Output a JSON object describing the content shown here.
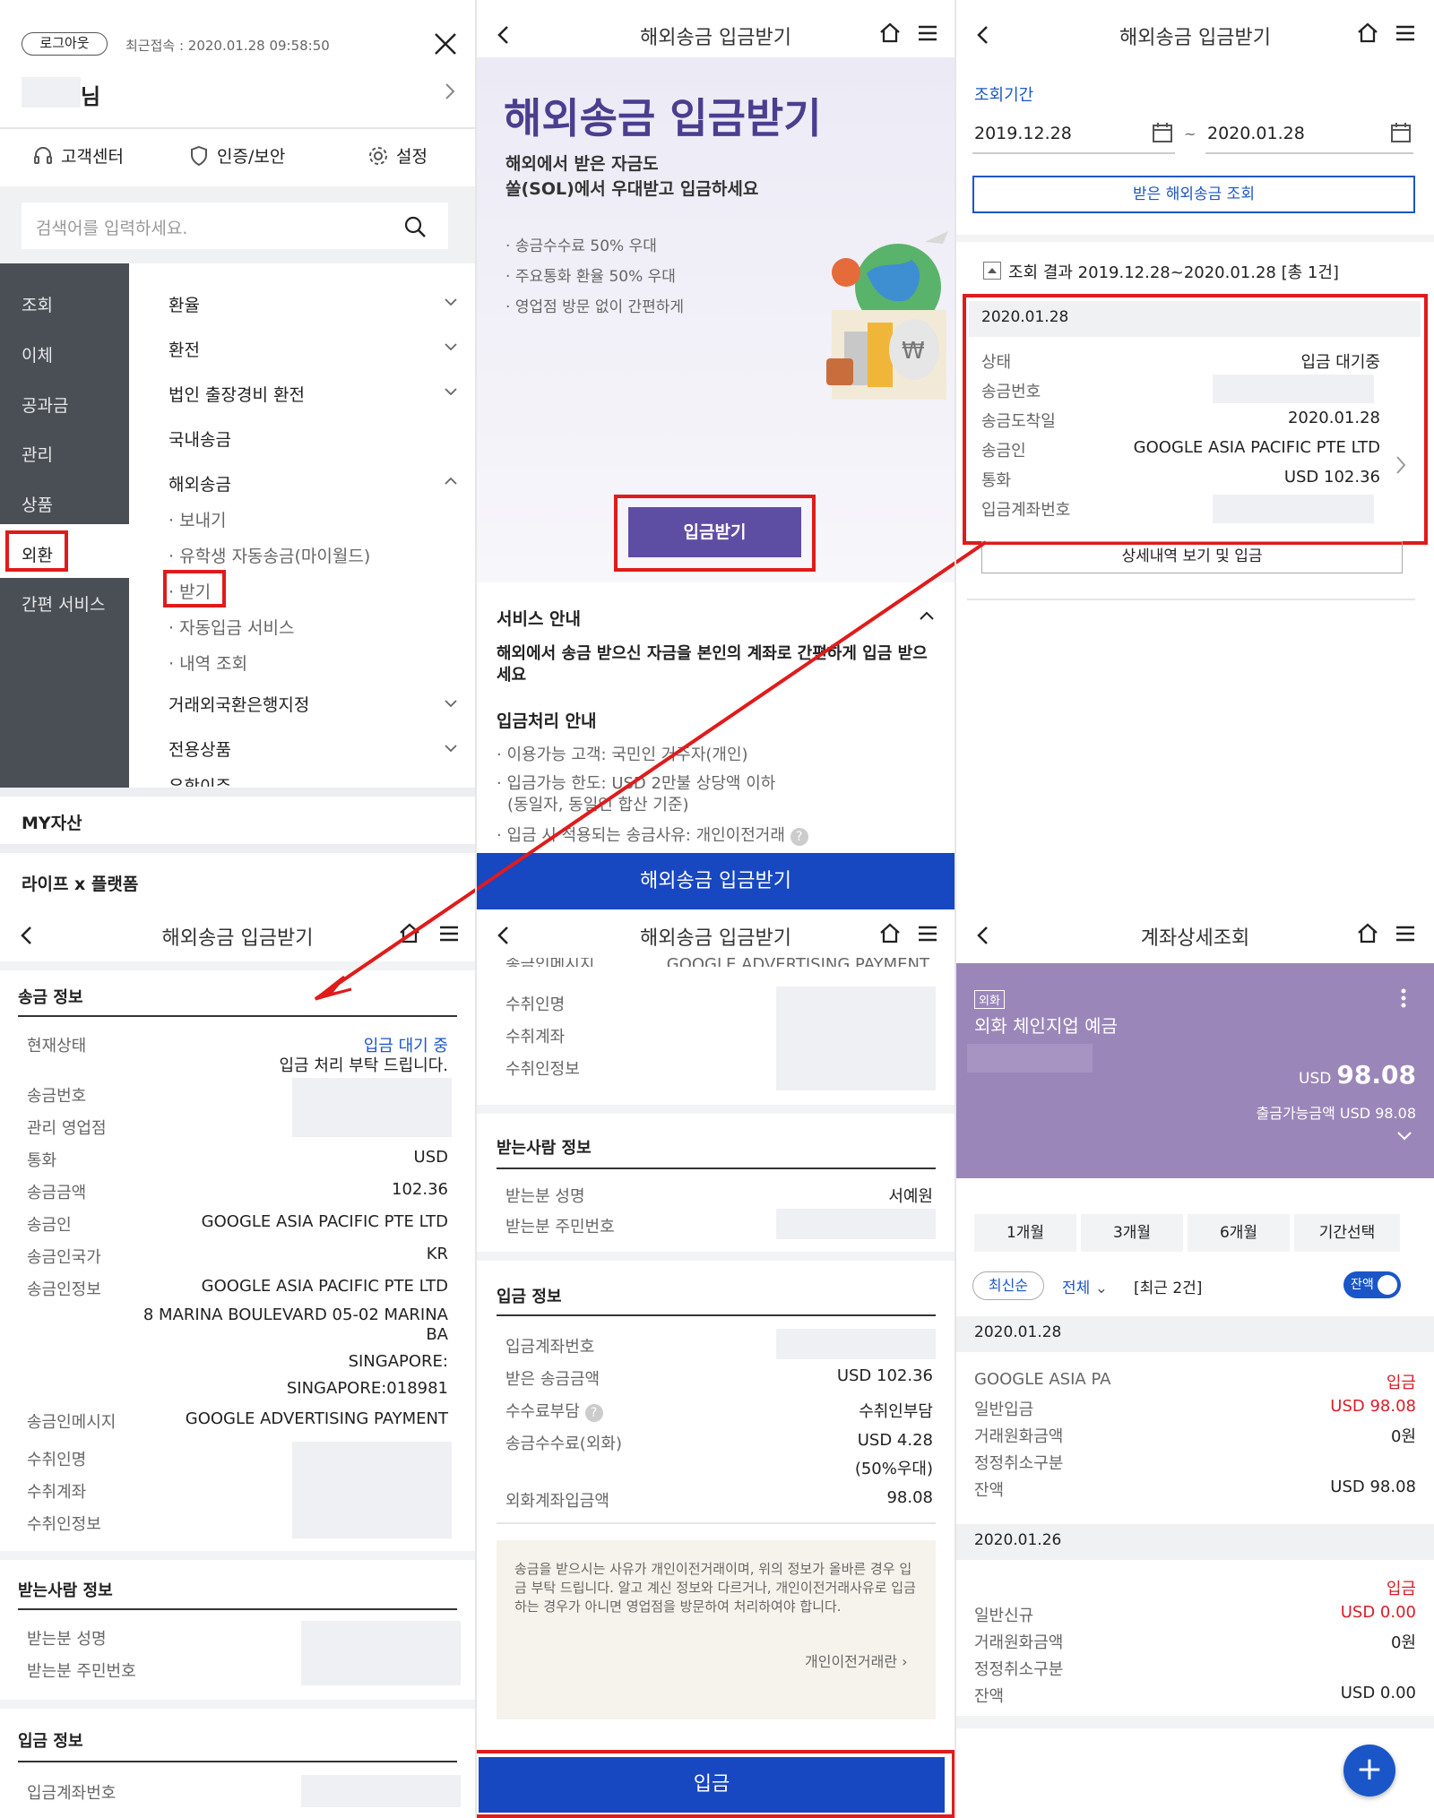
{
  "colors": {
    "brand_purple": "#4b3e8f",
    "menu_dark": "#4a4f56",
    "blue_bar": "#1747c1",
    "red": "#e01b1b",
    "card_purple": "#9b86b9",
    "link_blue": "#1a56c8"
  },
  "p1": {
    "logout": "로그아웃",
    "last_login": "최근접속 : 2020.01.28 09:58:50",
    "user_suffix": "님",
    "shortcuts": [
      "고객센터",
      "인증/보안",
      "설정"
    ],
    "search_placeholder": "검색어를 입력하세요.",
    "left_menu": [
      "조회",
      "이체",
      "공과금",
      "관리",
      "상품",
      "외환",
      "간편 서비스"
    ],
    "right_menu": [
      "환율",
      "환전",
      "법인 출장경비 환전",
      "국내송금",
      "해외송금"
    ],
    "sub_menu": [
      "보내기",
      "유학생 자동송금(마이월드)",
      "받기",
      "자동입금 서비스",
      "내역 조회"
    ],
    "right_menu2": [
      "거래외국환은행지정",
      "전용상품"
    ],
    "partial": "유학이주",
    "my_assets": "MY자산",
    "life": "라이프 x 플랫폼"
  },
  "p2": {
    "header": "해외송금 입금받기",
    "hero_title": "해외송금 입금받기",
    "hero_sub1": "해외에서 받은 자금도",
    "hero_sub2": "쏠(SOL)에서 우대받고 입금하세요",
    "bullets": [
      "송금수수료 50% 우대",
      "주요통화 환율 50% 우대",
      "영업점 방문 없이 간편하게"
    ],
    "receive_btn": "입금받기",
    "service_title": "서비스 안내",
    "service_desc": "해외에서 송금 받으신 자금을 본인의 계좌로 간편하게 입금 받으세요",
    "process_title": "입금처리 안내",
    "process": [
      "이용가능 고객: 국민인 거주자(개인)",
      "입금가능 한도: USD 2만불 상당액 이하",
      "입금 시 적용되는 송금사유: 개인이전거래"
    ],
    "process_note": "(동일자, 동일인 합산 기준)",
    "bottom_btn": "해외송금 입금받기"
  },
  "p3": {
    "header": "해외송금 입금받기",
    "period_label": "조회기간",
    "date_from": "2019.12.28",
    "tilde": "~",
    "date_to": "2020.01.28",
    "query_btn": "받은 해외송금 조회",
    "result": "조회 결과 2019.12.28~2020.01.28 [총 1건]",
    "item_date": "2020.01.28",
    "labels": [
      "상태",
      "송금번호",
      "송금도착일",
      "송금인",
      "통화",
      "입금계좌번호"
    ],
    "values": [
      "입금 대기중",
      "",
      "2020.01.28",
      "GOOGLE ASIA PACIFIC PTE LTD",
      "USD 102.36",
      ""
    ],
    "detail_btn": "상세내역 보기 및 입금"
  },
  "p4": {
    "header": "해외송금 입금받기",
    "section1": "송금 정보",
    "status_label": "현재상태",
    "status_value": "입금 대기 중",
    "status_note": "입금 처리 부탁 드립니다.",
    "rows": [
      {
        "label": "송금번호",
        "value": ""
      },
      {
        "label": "관리 영업점",
        "value": ""
      },
      {
        "label": "통화",
        "value": "USD"
      },
      {
        "label": "송금금액",
        "value": "102.36"
      },
      {
        "label": "송금인",
        "value": "GOOGLE ASIA PACIFIC PTE LTD"
      },
      {
        "label": "송금인국가",
        "value": "KR"
      }
    ],
    "sender_info_label": "송금인정보",
    "sender_info_lines": [
      "GOOGLE ASIA PACIFIC PTE LTD",
      "8 MARINA BOULEVARD 05-02 MARINA",
      "BA",
      "SINGAPORE:",
      "SINGAPORE:018981"
    ],
    "msg_label": "송금인메시지",
    "msg_value": "GOOGLE ADVERTISING PAYMENT",
    "rcpt_labels": [
      "수취인명",
      "수취계좌",
      "수취인정보"
    ],
    "section2": "받는사람 정보",
    "recv_labels": [
      "받는분 성명",
      "받는분 주민번호"
    ],
    "section3": "입금 정보",
    "deposit_acct": "입금계좌번호"
  },
  "p5": {
    "header": "해외송금 입금받기",
    "cut_left": "송금인메시지",
    "cut_right": "GOOGLE ADVERTISING PAYMENT",
    "rcpt_labels": [
      "수취인명",
      "수취계좌",
      "수취인정보"
    ],
    "section_recv": "받는사람 정보",
    "recv_name_label": "받는분 성명",
    "recv_name": "서예원",
    "recv_id_label": "받는분 주민번호",
    "section_dep": "입금 정보",
    "dep_rows": [
      {
        "label": "입금계좌번호",
        "value": ""
      },
      {
        "label": "받은 송금금액",
        "value": "USD 102.36"
      },
      {
        "label": "수수료부담",
        "value": "수취인부담"
      },
      {
        "label": "송금수수료(외화)",
        "value": "USD 4.28"
      },
      {
        "label": "외화계좌입금액",
        "value": "98.08"
      }
    ],
    "fee_note": "(50%우대)",
    "notice": "송금을 받으시는 사유가 개인이전거래이며, 위의 정보가 올바른 경우 입금 부탁 드립니다. 알고 계신 정보와 다르거나, 개인이전거래사유로 입금하는 경우가 아니면 영업점을 방문하여 처리하여야 합니다.",
    "notice_link": "개인이전거래란",
    "deposit_btn": "입금"
  },
  "p6": {
    "header": "계좌상세조회",
    "badge": "외화",
    "acct_name": "외화 체인지업 예금",
    "balance_cur": "USD",
    "balance": "98.08",
    "avail": "출금가능금액 USD 98.08",
    "tabs": [
      "1개월",
      "3개월",
      "6개월",
      "기간선택"
    ],
    "sort": "최신순",
    "filter": "전체",
    "count": "[최근 2건]",
    "toggle": "잔액",
    "tx": [
      {
        "date": "2020.01.28",
        "name": "GOOGLE ASIA PA",
        "type": "입금",
        "memo": "일반입금",
        "amount": "USD 98.08",
        "krw_label": "거래원화금액",
        "krw": "0원",
        "cancel_label": "정정취소구분",
        "bal_label": "잔액",
        "bal": "USD 98.08"
      },
      {
        "date": "2020.01.26",
        "name": "",
        "type": "입금",
        "memo": "일반신규",
        "amount": "USD 0.00",
        "krw_label": "거래원화금액",
        "krw": "0원",
        "cancel_label": "정정취소구분",
        "bal_label": "잔액",
        "bal": "USD 0.00"
      }
    ],
    "fab": "+"
  }
}
